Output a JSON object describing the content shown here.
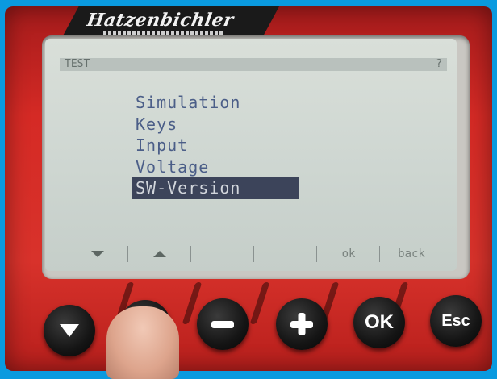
{
  "device": {
    "brand": "Hatzenbichler"
  },
  "lcd": {
    "title": "TEST",
    "corner_indicator": "?",
    "menu_items": [
      "Simulation",
      "Keys",
      "Input",
      "Voltage",
      "SW-Version"
    ],
    "selected_index": 4,
    "softkeys": [
      {
        "icon": "arrow-down-icon",
        "label": ""
      },
      {
        "icon": "arrow-up-icon",
        "label": ""
      },
      {
        "icon": "",
        "label": ""
      },
      {
        "icon": "",
        "label": ""
      },
      {
        "icon": "",
        "label": "ok"
      },
      {
        "icon": "",
        "label": "back"
      }
    ]
  },
  "buttons": [
    {
      "name": "down-button",
      "icon": "arrow-down-icon",
      "text": ""
    },
    {
      "name": "up-button",
      "icon": "arrow-up-icon",
      "text": ""
    },
    {
      "name": "minus-button",
      "icon": "minus-icon",
      "text": ""
    },
    {
      "name": "plus-button",
      "icon": "plus-icon",
      "text": ""
    },
    {
      "name": "ok-button",
      "icon": "",
      "text": "OK"
    },
    {
      "name": "esc-button",
      "icon": "",
      "text": "Esc"
    }
  ],
  "colors": {
    "background": "#0a9adf",
    "device_red": "#d52a25",
    "lcd_text": "#4b5e88",
    "selection_bg": "#3c445a",
    "button_black": "#151515"
  }
}
